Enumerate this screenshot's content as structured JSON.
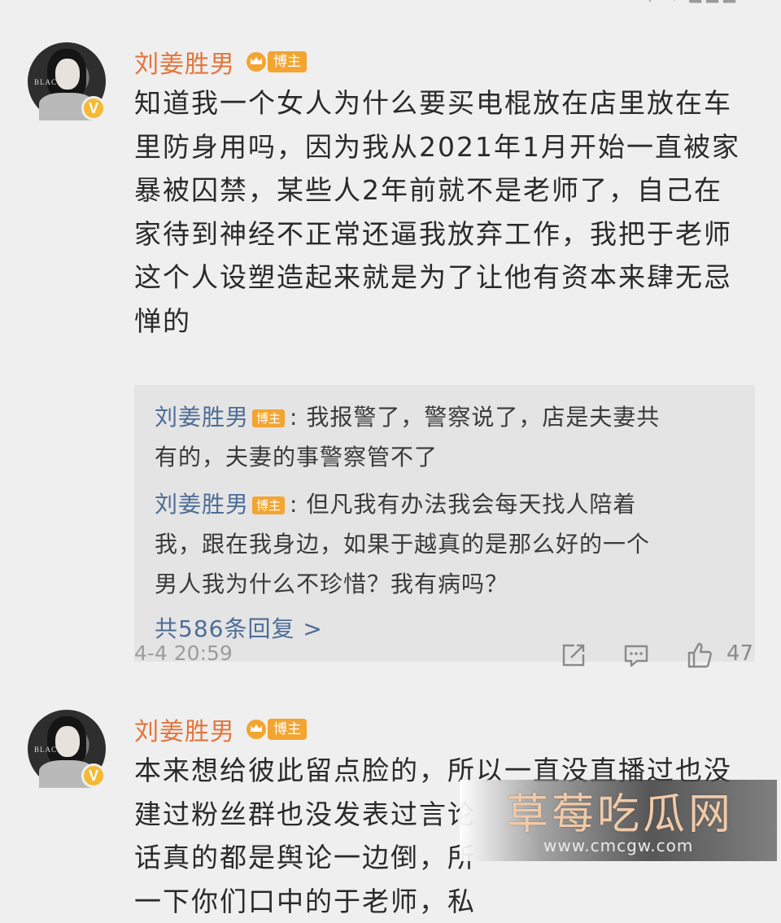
{
  "comments": [
    {
      "username": "刘姜胜男",
      "tag": "博主",
      "avatar_brand": "BLAC",
      "verified_mark": "V",
      "text_lines": [
        "知道我一个女人为什么要买电棍放在店里放在车",
        "里防身用吗，因为我从2021年1月开始一直被家",
        "暴被囚禁，某些人2年前就不是老师了，自己在",
        "家待到神经不正常还逼我放弃工作，我把于老师",
        "这个人设塑造起来就是为了让他有资本来肆无忌",
        "惮的"
      ],
      "replies": [
        {
          "author": "刘姜胜男",
          "tag": "博主",
          "text_lines": [
            "我报警了，警察说了，店是夫妻共",
            "有的，夫妻的事警察管不了"
          ]
        },
        {
          "author": "刘姜胜男",
          "tag": "博主",
          "text_lines": [
            "但凡我有办法我会每天找人陪着",
            "我，跟在我身边，如果于越真的是那么好的一个",
            "男人我为什么不珍惜？我有病吗？"
          ]
        }
      ],
      "reply_count_label": "共586条回复 >",
      "timestamp": "4-4 20:59",
      "like_count": "47"
    },
    {
      "username": "刘姜胜男",
      "tag": "博主",
      "avatar_brand": "BLAC",
      "verified_mark": "V",
      "text_lines": [
        "本来想给彼此留点脸的，所以一直没直播过也没",
        "建过粉丝群也没发表过言论",
        "话真的都是舆论一边倒，所",
        "一下你们口中的于老师，私"
      ]
    }
  ],
  "watermark": {
    "title": "草莓吃瓜网",
    "url": "www.cmcgw.com"
  },
  "colors": {
    "username": "#e2753a",
    "reply_author": "#4e6d96",
    "tag_bg": "#f3a531",
    "verified": "#f6b934",
    "background": "#efefef",
    "reply_bg": "#e4e4e4"
  }
}
